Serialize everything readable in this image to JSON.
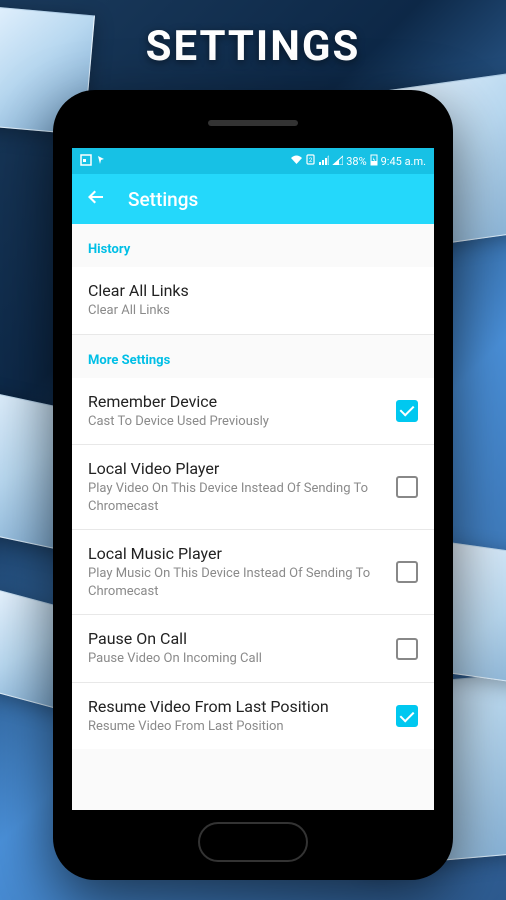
{
  "pageTitle": "SETTINGS",
  "statusBar": {
    "battery": "38%",
    "time": "9:45 a.m."
  },
  "appBar": {
    "title": "Settings"
  },
  "sections": {
    "history": {
      "header": "History",
      "clearLinks": {
        "title": "Clear All Links",
        "desc": "Clear All Links"
      }
    },
    "more": {
      "header": "More Settings",
      "remember": {
        "title": "Remember Device",
        "desc": "Cast To Device Used Previously",
        "checked": true
      },
      "localVideo": {
        "title": "Local Video Player",
        "desc": "Play Video On This Device Instead Of Sending To Chromecast",
        "checked": false
      },
      "localMusic": {
        "title": "Local Music Player",
        "desc": "Play Music On This Device Instead Of Sending To Chromecast",
        "checked": false
      },
      "pauseCall": {
        "title": "Pause On Call",
        "desc": "Pause Video On Incoming Call",
        "checked": false
      },
      "resume": {
        "title": "Resume Video From Last Position",
        "desc": "Resume Video From Last Position",
        "checked": true
      }
    }
  }
}
